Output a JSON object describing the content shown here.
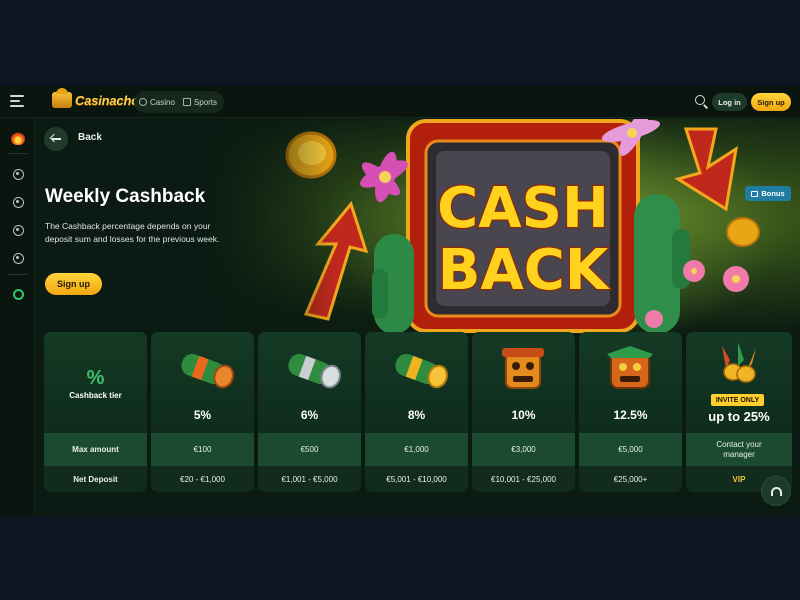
{
  "header": {
    "logo_text": "Casinacho",
    "nav": [
      {
        "label": "Casino",
        "icon": "casino-chip-icon"
      },
      {
        "label": "Sports",
        "icon": "sports-grid-icon"
      }
    ],
    "login_label": "Log in",
    "signup_label": "Sign up"
  },
  "sidebar": {
    "items": [
      "fire-promo-icon",
      "casino-chip-icon",
      "sports-ball-icon",
      "dice-icon",
      "joystick-icon",
      "live-support-icon"
    ]
  },
  "hero": {
    "back_label": "Back",
    "title": "Weekly Cashback",
    "description": "The Cashback percentage depends on your deposit sum and losses for the previous week.",
    "signup_label": "Sign up",
    "badge_label": "Bonus",
    "art_text_line1": "CASH",
    "art_text_line2": "BACK"
  },
  "tiers": {
    "label_column": {
      "symbol": "%",
      "header": "Cashback tier",
      "max_amount_label": "Max amount",
      "net_deposit_label": "Net Deposit"
    },
    "rows": [
      {
        "percent": "5%",
        "max_amount": "€100",
        "net_deposit": "€20 - €1,000",
        "icon": "money-roll-orange-icon"
      },
      {
        "percent": "6%",
        "max_amount": "€500",
        "net_deposit": "€1,001 - €5,000",
        "icon": "money-roll-silver-icon"
      },
      {
        "percent": "8%",
        "max_amount": "€1,000",
        "net_deposit": "€5,001 - €10,000",
        "icon": "money-roll-gold-icon"
      },
      {
        "percent": "10%",
        "max_amount": "€3,000",
        "net_deposit": "€10,001 - €25,000",
        "icon": "tiki-mask-orange-icon"
      },
      {
        "percent": "12.5%",
        "max_amount": "€5,000",
        "net_deposit": "€25,000+",
        "icon": "tiki-mask-green-icon"
      },
      {
        "percent": "up to 25%",
        "max_amount": "Contact your manager",
        "net_deposit": "VIP",
        "icon": "coins-feathers-icon",
        "badge": "INVITE ONLY"
      }
    ]
  },
  "colors": {
    "accent_yellow": "#ffd43b",
    "bg_dark": "#0b1a12",
    "tier_card": "#112c1d",
    "tier_band": "#1b4a30",
    "bonus_badge": "#1e7da0"
  }
}
